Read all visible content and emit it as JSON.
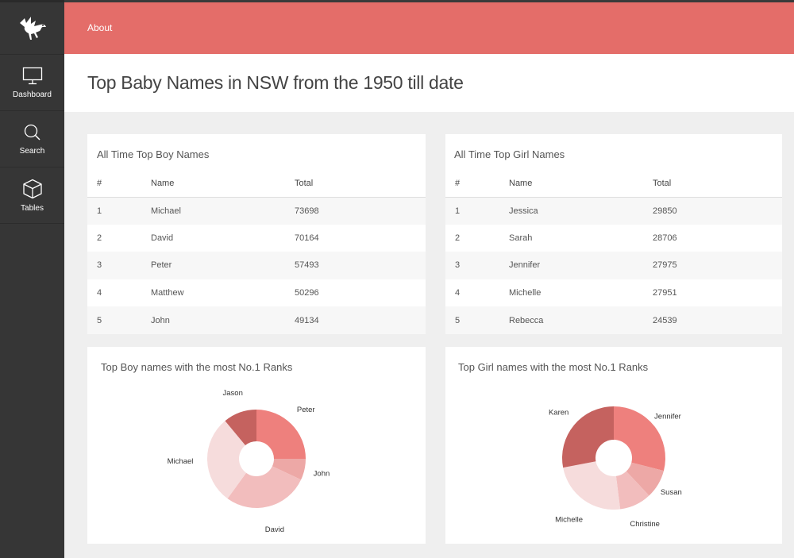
{
  "sidebar": {
    "logo_icon": "stork-icon",
    "items": [
      {
        "label": "Dashboard",
        "icon": "monitor-icon"
      },
      {
        "label": "Search",
        "icon": "search-icon"
      },
      {
        "label": "Tables",
        "icon": "cube-icon"
      }
    ]
  },
  "topbar": {
    "about_label": "About"
  },
  "page": {
    "title": "Top Baby Names in NSW from the 1950 till date"
  },
  "boy_table": {
    "title": "All Time Top Boy Names",
    "headers": [
      "#",
      "Name",
      "Total"
    ],
    "rows": [
      [
        "1",
        "Michael",
        "73698"
      ],
      [
        "2",
        "David",
        "70164"
      ],
      [
        "3",
        "Peter",
        "57493"
      ],
      [
        "4",
        "Matthew",
        "50296"
      ],
      [
        "5",
        "John",
        "49134"
      ]
    ]
  },
  "girl_table": {
    "title": "All Time Top Girl Names",
    "headers": [
      "#",
      "Name",
      "Total"
    ],
    "rows": [
      [
        "1",
        "Jessica",
        "29850"
      ],
      [
        "2",
        "Sarah",
        "28706"
      ],
      [
        "3",
        "Jennifer",
        "27975"
      ],
      [
        "4",
        "Michelle",
        "27951"
      ],
      [
        "5",
        "Rebecca",
        "24539"
      ]
    ]
  },
  "colors": {
    "accent": "#e46d69",
    "sidebar": "#363636"
  },
  "chart_data": [
    {
      "type": "pie",
      "title": "Top Boy names with the most No.1 Ranks",
      "categories": [
        "Peter",
        "John",
        "David",
        "Michael",
        "Jason"
      ],
      "values": [
        25,
        7,
        28,
        29,
        11
      ],
      "colors": [
        "#ee807d",
        "#eda8a6",
        "#f2bdbd",
        "#f6dcdc",
        "#c5625f"
      ]
    },
    {
      "type": "pie",
      "title": "Top Girl names with the most No.1 Ranks",
      "categories": [
        "Jennifer",
        "Susan",
        "Christine",
        "Michelle",
        "Karen"
      ],
      "values": [
        29,
        9,
        10,
        24,
        28
      ],
      "colors": [
        "#ee807d",
        "#eda8a6",
        "#f2bdbd",
        "#f6dcdc",
        "#c5625f"
      ]
    }
  ]
}
